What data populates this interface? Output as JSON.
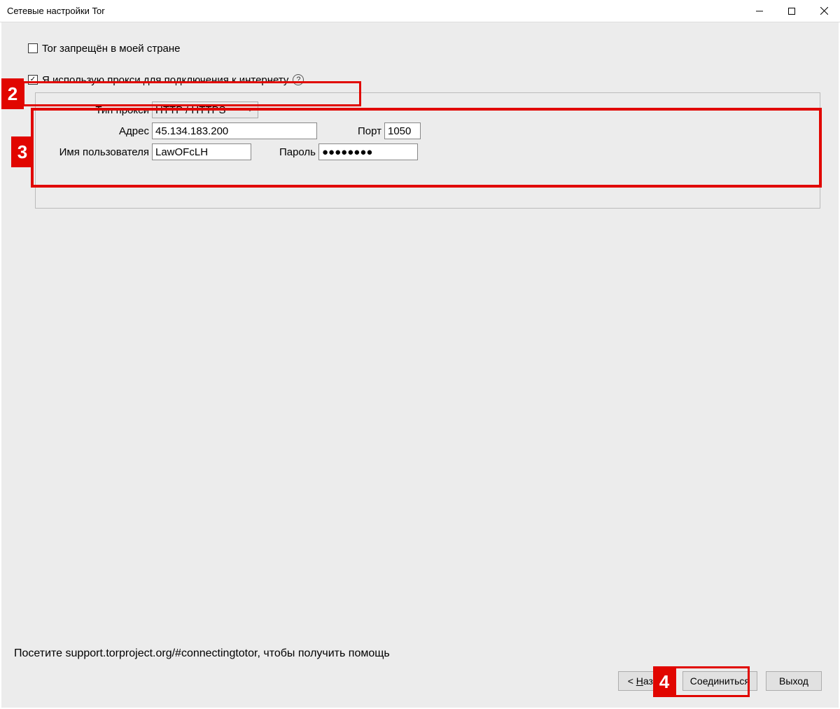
{
  "window": {
    "title": "Сетевые настройки Tor"
  },
  "checkboxes": {
    "tor_censored": {
      "label": "Tor запрещён в моей стране",
      "checked": false
    },
    "use_proxy": {
      "label": "Я использую прокси для подключения к интернету",
      "checked": true
    }
  },
  "proxy": {
    "type_label": "Тип прокси",
    "type_value": "HTTP / HTTPS",
    "address_label": "Адрес",
    "address_value": "45.134.183.200",
    "port_label": "Порт",
    "port_value": "1050",
    "username_label": "Имя пользователя",
    "username_value": "LawOFcLH",
    "password_label": "Пароль",
    "password_value": "●●●●●●●●"
  },
  "footer": {
    "help_text": "Посетите support.torproject.org/#connectingtotor, чтобы получить помощь"
  },
  "buttons": {
    "back_prefix": "< ",
    "back_u": "Н",
    "back_rest": "азад",
    "connect": "Соединиться",
    "exit": "Выход"
  },
  "callouts": {
    "c2": "2",
    "c3": "3",
    "c4": "4"
  }
}
